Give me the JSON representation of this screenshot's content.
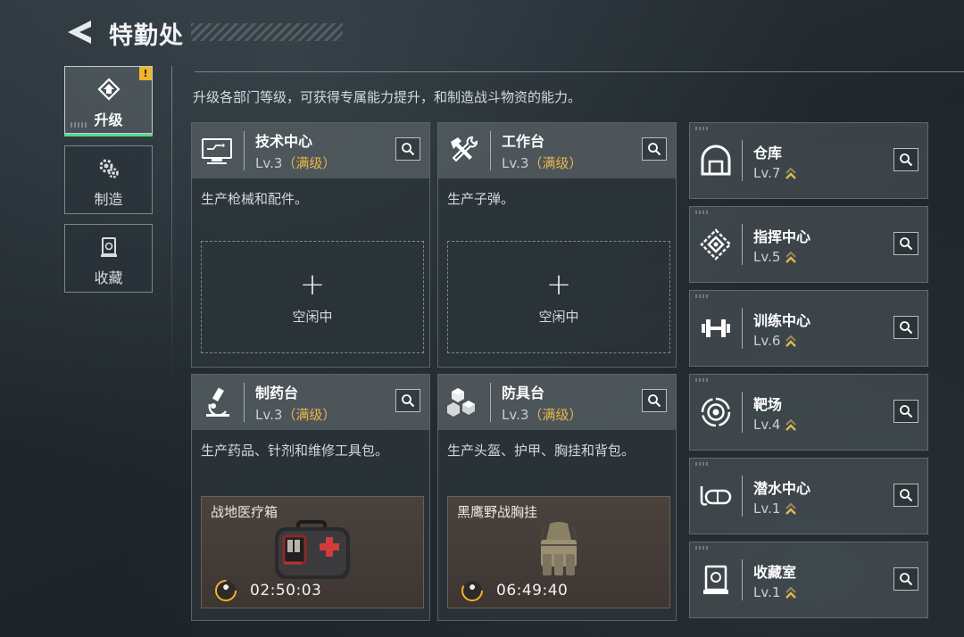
{
  "header": {
    "title": "特勤处",
    "back_icon": "back-arrow-icon"
  },
  "sidebar": {
    "items": [
      {
        "label": "升级",
        "icon": "upgrade-icon",
        "active": true,
        "alert": "!"
      },
      {
        "label": "制造",
        "icon": "gears-icon",
        "active": false
      },
      {
        "label": "收藏",
        "icon": "collection-icon",
        "active": false
      }
    ]
  },
  "description": "升级各部门等级，可获得专属能力提升，和制造战斗物资的能力。",
  "facilities": [
    {
      "name": "技术中心",
      "level": "Lv.3",
      "max_label": "（满级）",
      "icon": "computer-icon",
      "desc": "生产枪械和配件。",
      "slot": {
        "state": "idle",
        "plus": "+",
        "status": "空闲中"
      }
    },
    {
      "name": "工作台",
      "level": "Lv.3",
      "max_label": "（满级）",
      "icon": "hammer-wrench-icon",
      "desc": "生产子弹。",
      "slot": {
        "state": "idle",
        "plus": "+",
        "status": "空闲中"
      }
    },
    {
      "name": "制药台",
      "level": "Lv.3",
      "max_label": "（满级）",
      "icon": "microscope-icon",
      "desc": "生产药品、针剂和维修工具包。",
      "slot": {
        "state": "producing",
        "item": "战地医疗箱",
        "timer": "02:50:03"
      }
    },
    {
      "name": "防具台",
      "level": "Lv.3",
      "max_label": "（满级）",
      "icon": "armor-cubes-icon",
      "desc": "生产头盔、护甲、胸挂和背包。",
      "slot": {
        "state": "producing",
        "item": "黑鹰野战胸挂",
        "timer": "06:49:40"
      }
    }
  ],
  "side_facilities": [
    {
      "name": "仓库",
      "level": "Lv.7",
      "icon": "warehouse-icon",
      "upgradable": true
    },
    {
      "name": "指挥中心",
      "level": "Lv.5",
      "icon": "command-center-icon",
      "upgradable": true
    },
    {
      "name": "训练中心",
      "level": "Lv.6",
      "icon": "dumbbell-icon",
      "upgradable": true
    },
    {
      "name": "靶场",
      "level": "Lv.4",
      "icon": "target-icon",
      "upgradable": true
    },
    {
      "name": "潜水中心",
      "level": "Lv.1",
      "icon": "diving-mask-icon",
      "upgradable": true
    },
    {
      "name": "收藏室",
      "level": "Lv.1",
      "icon": "collection-room-icon",
      "upgradable": true
    }
  ],
  "colors": {
    "accent_green": "#59d68c",
    "max_level_gold": "#e8b64a",
    "alert_yellow": "#f0b429",
    "upgrade_chevron": "#e0b84e"
  }
}
